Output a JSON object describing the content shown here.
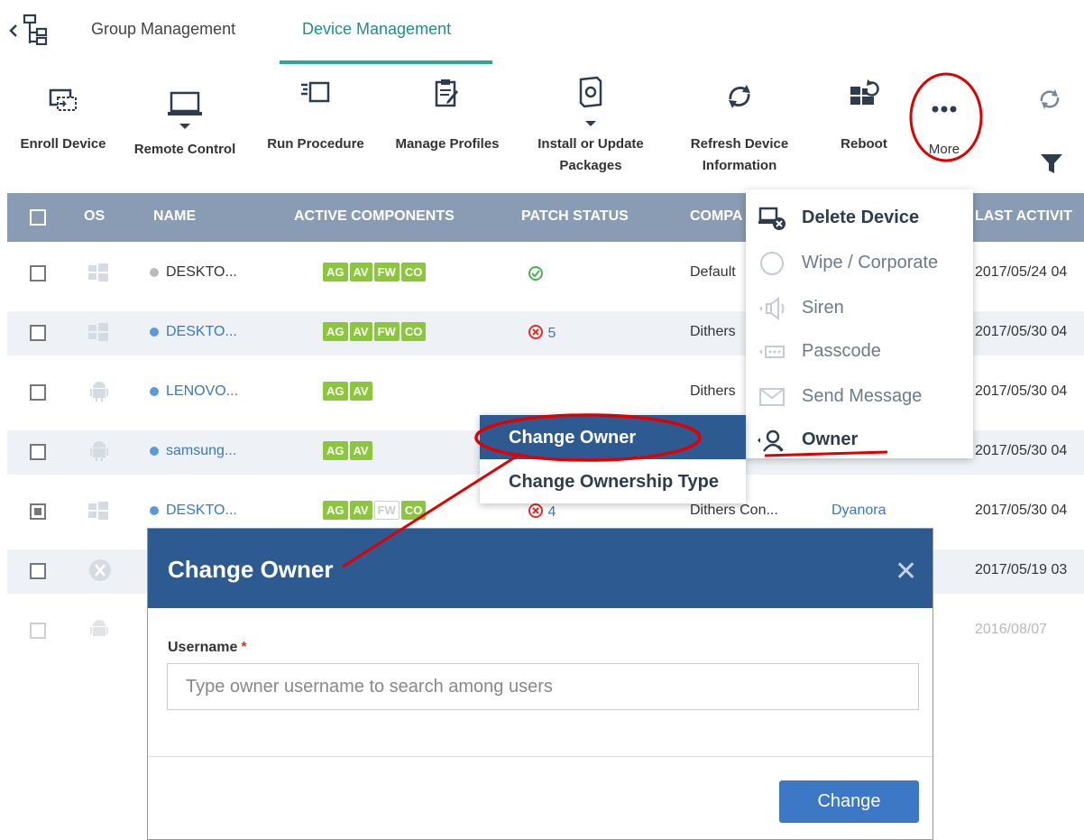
{
  "tabs": {
    "group_management": "Group Management",
    "device_management": "Device Management"
  },
  "toolbar": {
    "enroll_device": "Enroll Device",
    "remote_control": "Remote Control",
    "run_procedure": "Run Procedure",
    "manage_profiles": "Manage Profiles",
    "install_update": "Install or Update\nPackages",
    "refresh_info": "Refresh Device\nInformation",
    "reboot": "Reboot",
    "more": "More"
  },
  "table": {
    "headers": {
      "os": "OS",
      "name": "NAME",
      "active_components": "ACTIVE COMPONENTS",
      "patch_status": "PATCH STATUS",
      "company": "COMPA",
      "last_activity": "LAST ACTIVIT"
    },
    "rows": [
      {
        "name": "DESKTO...",
        "company": "Default",
        "patch": "",
        "owner": "",
        "last": "2017/05/24 04"
      },
      {
        "name": "DESKTO...",
        "company": "Dithers",
        "patch": "5",
        "owner": "",
        "last": "2017/05/30 04"
      },
      {
        "name": "LENOVO...",
        "company": "Dithers",
        "patch": "",
        "owner": "",
        "last": "2017/05/30 04"
      },
      {
        "name": "samsung...",
        "company": "",
        "patch": "",
        "owner": "",
        "last": "2017/05/30 04"
      },
      {
        "name": "DESKTO...",
        "company": "Dithers Con...",
        "patch": "4",
        "owner": "Dyanora",
        "last": "2017/05/30 04"
      },
      {
        "name": "",
        "company": "",
        "patch": "",
        "owner": "",
        "last": "2017/05/19 03"
      },
      {
        "name": "",
        "company": "",
        "patch": "",
        "owner": "",
        "last": "2016/08/07"
      }
    ],
    "badges": {
      "ag": "AG",
      "av": "AV",
      "fw": "FW",
      "co": "CO"
    }
  },
  "more_menu": {
    "delete_device": "Delete Device",
    "wipe_corporate": "Wipe / Corporate",
    "siren": "Siren",
    "passcode": "Passcode",
    "send_message": "Send Message",
    "owner": "Owner"
  },
  "owner_submenu": {
    "change_owner": "Change Owner",
    "change_ownership_type": "Change Ownership Type"
  },
  "dialog": {
    "title": "Change Owner",
    "close": "✕",
    "username_label": "Username",
    "required_mark": "*",
    "username_placeholder": "Type owner username to search among users",
    "change_button": "Change"
  },
  "colors": {
    "accent_teal": "#2aa897",
    "header_gray": "#8a9cb3",
    "dialog_blue": "#2e5a92",
    "button_blue": "#3d78c7",
    "badge_green": "#8cc63e",
    "annotation_red": "#e00000"
  }
}
